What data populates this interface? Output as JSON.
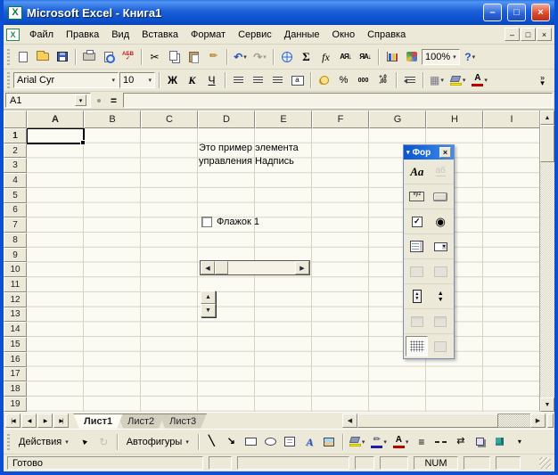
{
  "window": {
    "title": "Microsoft Excel - Книга1",
    "app_icon_letter": "X",
    "controls": {
      "minimize": "–",
      "maximize": "□",
      "close": "×"
    }
  },
  "menu": {
    "items": [
      "Файл",
      "Правка",
      "Вид",
      "Вставка",
      "Формат",
      "Сервис",
      "Данные",
      "Окно",
      "Справка"
    ],
    "window_controls": [
      "–",
      "□",
      "×"
    ]
  },
  "standard_toolbar": {
    "buttons": [
      {
        "name": "new-document"
      },
      {
        "name": "open"
      },
      {
        "name": "save"
      },
      {
        "sep": true
      },
      {
        "name": "print"
      },
      {
        "name": "print-preview"
      },
      {
        "name": "spelling",
        "glyph": "АБВ\n✓"
      },
      {
        "sep": true
      },
      {
        "name": "cut",
        "glyph": "✂"
      },
      {
        "name": "copy"
      },
      {
        "name": "paste"
      },
      {
        "name": "format-painter",
        "glyph": "✏"
      },
      {
        "sep": true
      },
      {
        "name": "undo",
        "glyph": "↶",
        "dropdown": true
      },
      {
        "name": "redo",
        "glyph": "↷",
        "dropdown": true,
        "disabled": true
      },
      {
        "sep": true
      },
      {
        "name": "insert-hyperlink"
      },
      {
        "name": "autosum",
        "glyph": "Σ"
      },
      {
        "name": "insert-function",
        "glyph": "fx"
      },
      {
        "name": "sort-ascending",
        "glyph": "АЯ↓"
      },
      {
        "name": "sort-descending",
        "glyph": "ЯА↓"
      },
      {
        "sep": true
      },
      {
        "name": "chart-wizard"
      },
      {
        "name": "drawing"
      },
      {
        "name": "zoom-box",
        "box": true,
        "value": "100%"
      },
      {
        "name": "help",
        "glyph": "?",
        "dropdown": true
      }
    ]
  },
  "formatting_toolbar": {
    "font_name": "Arial Cyr",
    "font_size": "10",
    "buttons": [
      {
        "name": "bold",
        "glyph": "Ж"
      },
      {
        "name": "italic",
        "glyph": "К"
      },
      {
        "name": "underline",
        "glyph": "Ч"
      },
      {
        "sep": true
      },
      {
        "name": "align-left"
      },
      {
        "name": "align-center"
      },
      {
        "name": "align-right"
      },
      {
        "name": "merge-center",
        "glyph": "а"
      },
      {
        "sep": true
      },
      {
        "name": "currency"
      },
      {
        "name": "percent",
        "glyph": "%"
      },
      {
        "name": "thousands",
        "glyph": "000"
      },
      {
        "name": "decimals",
        "glyph": "+,0\n,00"
      },
      {
        "sep": true
      },
      {
        "name": "decrease-indent"
      },
      {
        "sep": true
      },
      {
        "name": "borders",
        "glyph": "▦",
        "dropdown": true
      },
      {
        "name": "fill-color",
        "bar": "#ffef00",
        "dropdown": true
      },
      {
        "name": "font-color",
        "glyph": "А",
        "bar": "#dd0000",
        "dropdown": true
      },
      {
        "name": "chevron",
        "glyph": "»\n▾",
        "push_right": true
      }
    ]
  },
  "formula_bar": {
    "cell_reference": "A1",
    "equals": "="
  },
  "grid": {
    "columns": [
      "A",
      "B",
      "C",
      "D",
      "E",
      "F",
      "G",
      "H",
      "I"
    ],
    "visible_rows": 19,
    "selected_cell": "A1"
  },
  "sheet_objects": {
    "label": {
      "lines": [
        "Это пример элемента",
        "управления Надпись"
      ]
    },
    "checkbox": {
      "label": "Флажок 1",
      "checked": false
    },
    "scrollbar_control": {
      "left_arrow": "◀",
      "right_arrow": "▶"
    },
    "spinner_control": {
      "up_arrow": "▲",
      "down_arrow": "▼"
    }
  },
  "forms_toolbar": {
    "title": "Фор",
    "collapse_arrow": "▾",
    "close": "×",
    "buttons": [
      {
        "name": "label-control",
        "glyph": "Aa"
      },
      {
        "name": "edit-box",
        "glyph": "аб",
        "disabled": true
      },
      {
        "name": "group-box",
        "glyph": "xyz"
      },
      {
        "name": "button-control"
      },
      {
        "name": "checkbox-control",
        "glyph": "✓"
      },
      {
        "name": "option-button",
        "glyph": "◉"
      },
      {
        "name": "list-box"
      },
      {
        "name": "combo-box",
        "glyph": "▾"
      },
      {
        "name": "combo-list-edit",
        "disabled": true
      },
      {
        "name": "combo-drop-edit",
        "disabled": true
      },
      {
        "name": "scrollbar-tool",
        "glyph": "▲\n▼"
      },
      {
        "name": "spinner-tool",
        "glyph": "▲\n▼"
      },
      {
        "name": "control-properties",
        "disabled": true
      },
      {
        "name": "edit-code",
        "disabled": true
      },
      {
        "name": "toggle-grid",
        "pressed": true
      },
      {
        "name": "run-dialog",
        "disabled": true
      }
    ]
  },
  "sheet_tabs": {
    "nav": [
      "|◀",
      "◀",
      "▶",
      "▶|"
    ],
    "tabs": [
      "Лист1",
      "Лист2",
      "Лист3"
    ],
    "active_index": 0
  },
  "drawing_toolbar": {
    "buttons": [
      {
        "name": "draw-actions",
        "label": "Действия",
        "dropdown": true
      },
      {
        "name": "select-objects",
        "glyph": "▲"
      },
      {
        "name": "free-rotate",
        "glyph": "↻",
        "disabled": true
      },
      {
        "sep": true
      },
      {
        "name": "autoshapes",
        "label": "Автофигуры",
        "dropdown": true
      },
      {
        "sep": true
      },
      {
        "name": "line",
        "glyph": "╲"
      },
      {
        "name": "arrow",
        "glyph": "↘"
      },
      {
        "name": "rectangle"
      },
      {
        "name": "oval"
      },
      {
        "name": "text-box"
      },
      {
        "name": "wordart",
        "glyph": "А"
      },
      {
        "name": "clip-art"
      },
      {
        "sep": true
      },
      {
        "name": "fill-color",
        "bar": "#ffef00",
        "dropdown": true
      },
      {
        "name": "line-color",
        "glyph": "✏",
        "bar": "#2222cc",
        "dropdown": true
      },
      {
        "name": "font-color2",
        "glyph": "А",
        "bar": "#dd0000",
        "dropdown": true
      },
      {
        "name": "line-style",
        "glyph": "≡"
      },
      {
        "name": "dash-style"
      },
      {
        "name": "arrow-style",
        "glyph": "⇄"
      },
      {
        "name": "shadow"
      },
      {
        "name": "3d"
      },
      {
        "name": "more-buttons",
        "glyph": "▾"
      }
    ]
  },
  "status_bar": {
    "message": "Готово",
    "num_lock": "NUM"
  },
  "scrollbar_glyphs": {
    "up": "▲",
    "down": "▼",
    "left": "◀",
    "right": "▶"
  }
}
